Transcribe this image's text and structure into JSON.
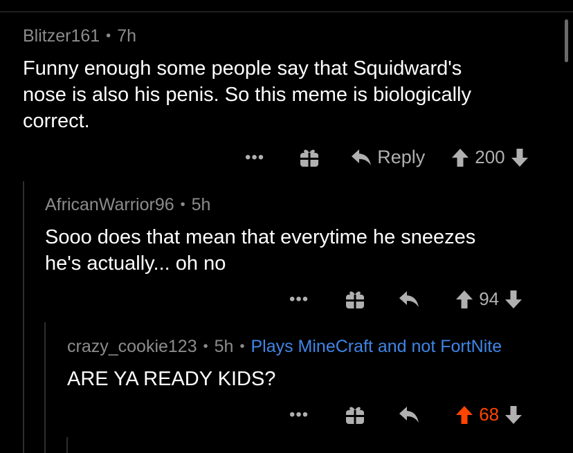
{
  "comments": [
    {
      "author": "Blitzer161",
      "time": "7h",
      "body": "Funny enough some people say that Squidward's\nnose is also his penis. So this meme is biologically\ncorrect.",
      "actions": {
        "more_label": "•••",
        "reply_label": "Reply",
        "score": "200"
      }
    },
    {
      "author": "AfricanWarrior96",
      "time": "5h",
      "body": "Sooo does that mean that everytime he sneezes\nhe's actually... oh no",
      "actions": {
        "more_label": "•••",
        "score": "94"
      }
    },
    {
      "author": "crazy_cookie123",
      "time": "5h",
      "flair": "Plays MineCraft and not FortNite",
      "body": "ARE YA READY KIDS?",
      "actions": {
        "more_label": "•••",
        "score": "68",
        "upvoted": true
      }
    }
  ],
  "separator": "•",
  "colors": {
    "background": "#000000",
    "text": "#ffffff",
    "meta": "#8c8c8c",
    "action": "#b0b0b0",
    "upvote_active": "#ff4500",
    "flair": "#3f86e6"
  },
  "icons": [
    "more-icon",
    "gift-icon",
    "reply-icon",
    "upvote-icon",
    "downvote-icon"
  ]
}
